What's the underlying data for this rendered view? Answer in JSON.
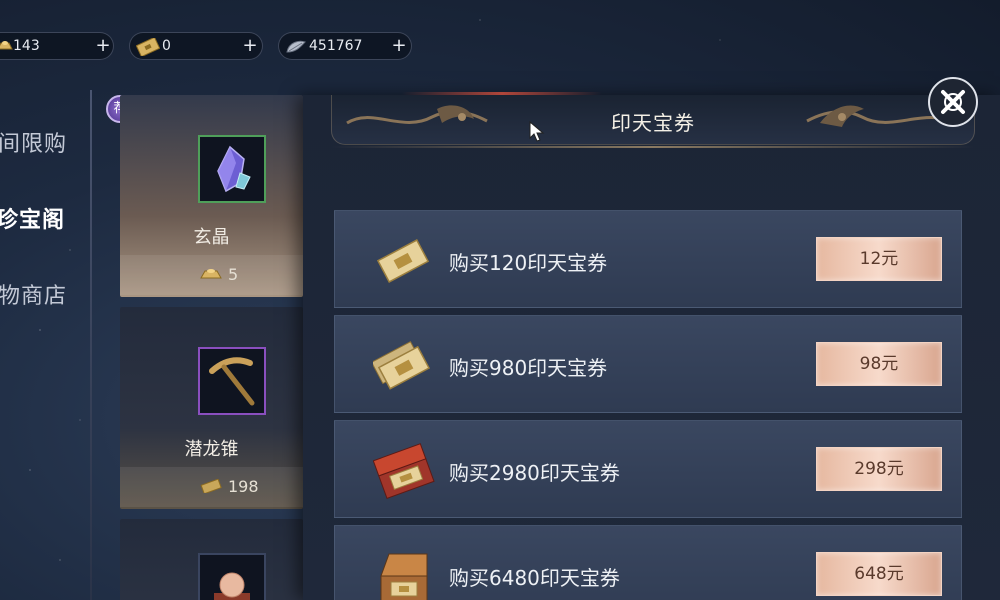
{
  "currency": {
    "gold": {
      "value": "143",
      "icon": "gold-ingot-icon"
    },
    "coupon": {
      "value": "0",
      "icon": "coupon-ticket-icon"
    },
    "silver": {
      "value": "451767",
      "icon": "silver-leaf-icon"
    },
    "plus_label": "+"
  },
  "nav": {
    "items": [
      {
        "label": "间限购",
        "active": false
      },
      {
        "label": "珍宝阁",
        "active": true
      },
      {
        "label": "物商店",
        "active": false
      }
    ]
  },
  "recommend_badge": "荐",
  "products": [
    {
      "name": "玄晶",
      "price": "5",
      "selected": true,
      "icon": "crystal-icon"
    },
    {
      "name": "潜龙锥",
      "price": "198",
      "selected": false,
      "icon": "pickaxe-icon"
    },
    {
      "name": "",
      "price": "",
      "selected": false,
      "icon": "orb-icon"
    }
  ],
  "modal": {
    "title": "印天宝券",
    "rows": [
      {
        "label": "购买120印天宝券",
        "price": "12元",
        "icon": "coupon-single-icon"
      },
      {
        "label": "购买980印天宝券",
        "price": "98元",
        "icon": "coupon-stack-icon"
      },
      {
        "label": "购买2980印天宝券",
        "price": "298元",
        "icon": "coupon-box-icon"
      },
      {
        "label": "购买6480印天宝券",
        "price": "648元",
        "icon": "coupon-chest-icon"
      }
    ]
  },
  "colors": {
    "accent_gold": "#d9b463",
    "buy_button": "#f0c9b5",
    "panel_bg": "#1f283a",
    "row_bg": "#34415a"
  }
}
